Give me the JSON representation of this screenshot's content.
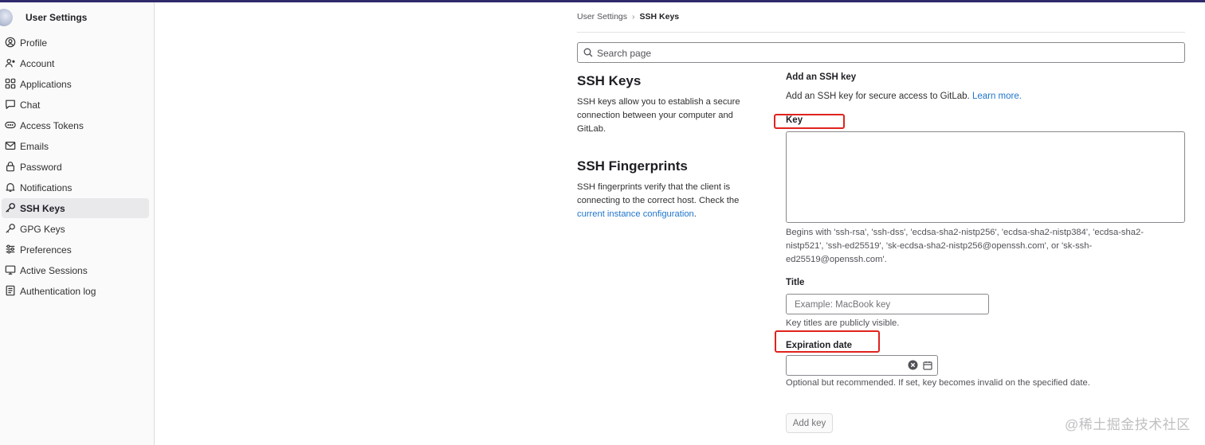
{
  "sidebar": {
    "title": "User Settings",
    "items": [
      {
        "label": "Profile",
        "icon": "profile-icon"
      },
      {
        "label": "Account",
        "icon": "account-icon"
      },
      {
        "label": "Applications",
        "icon": "applications-icon"
      },
      {
        "label": "Chat",
        "icon": "chat-icon"
      },
      {
        "label": "Access Tokens",
        "icon": "token-icon"
      },
      {
        "label": "Emails",
        "icon": "mail-icon"
      },
      {
        "label": "Password",
        "icon": "lock-icon"
      },
      {
        "label": "Notifications",
        "icon": "bell-icon"
      },
      {
        "label": "SSH Keys",
        "icon": "key-icon",
        "active": true
      },
      {
        "label": "GPG Keys",
        "icon": "key-icon"
      },
      {
        "label": "Preferences",
        "icon": "preferences-icon"
      },
      {
        "label": "Active Sessions",
        "icon": "monitor-icon"
      },
      {
        "label": "Authentication log",
        "icon": "log-icon"
      }
    ]
  },
  "breadcrumb": {
    "parent": "User Settings",
    "current": "SSH Keys"
  },
  "search": {
    "placeholder": "Search page"
  },
  "ssh_keys_section": {
    "heading": "SSH Keys",
    "description": "SSH keys allow you to establish a secure connection between your computer and GitLab."
  },
  "fingerprints_section": {
    "heading": "SSH Fingerprints",
    "description_before": "SSH fingerprints verify that the client is connecting to the correct host. Check the ",
    "link_text": "current instance configuration",
    "description_after": "."
  },
  "form": {
    "title": "Add an SSH key",
    "description": "Add an SSH key for secure access to GitLab. ",
    "learn_more": "Learn more.",
    "key_label": "Key",
    "key_value": "",
    "key_help": "Begins with 'ssh-rsa', 'ssh-dss', 'ecdsa-sha2-nistp256', 'ecdsa-sha2-nistp384', 'ecdsa-sha2-nistp521', 'ssh-ed25519', 'sk-ecdsa-sha2-nistp256@openssh.com', or 'sk-ssh-ed25519@openssh.com'.",
    "title_label": "Title",
    "title_placeholder": "Example: MacBook key",
    "title_help": "Key titles are publicly visible.",
    "expiration_label": "Expiration date",
    "expiration_value": "",
    "expiration_help": "Optional but recommended. If set, key becomes invalid on the specified date.",
    "submit_label": "Add key"
  },
  "annotation_color": "#e0231d",
  "link_color": "#1f75cb",
  "watermark": "@稀土掘金技术社区"
}
